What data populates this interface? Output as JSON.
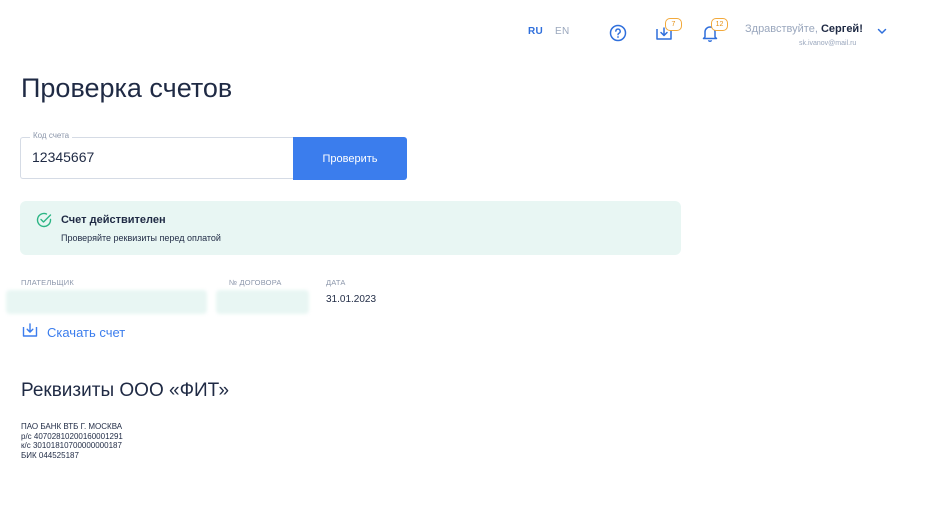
{
  "header": {
    "lang_ru": "RU",
    "lang_en": "EN",
    "downloads_count": "7",
    "notifications_count": "12",
    "greeting_prefix": "Здравствуйте, ",
    "user_name": "Сергей!",
    "email": "sk.ivanov@mail.ru",
    "icons": [
      "help-icon",
      "download-tray-icon",
      "bell-icon",
      "chevron-down-icon"
    ]
  },
  "page": {
    "title": "Проверка счетов"
  },
  "form": {
    "field_label": "Код счета",
    "field_value": "12345667",
    "submit_label": "Проверить"
  },
  "alert": {
    "title": "Счет действителен",
    "subtitle": "Проверяйте реквизиты перед оплатой",
    "icon": "check-circle-icon"
  },
  "invoice": {
    "payer_label": "ПЛАТЕЛЬЩИК",
    "contract_label": "№ ДОГОВОРА",
    "date_label": "ДАТА",
    "date_value": "31.01.2023",
    "download_label": "Скачать счет"
  },
  "requisites": {
    "title": "Реквизиты ООО «ФИТ»",
    "lines": [
      "ПАО БАНК ВТБ Г. МОСКВА",
      "р/с 40702810200160001291",
      "к/с 30101810700000000187",
      "БИК 044525187"
    ]
  },
  "colors": {
    "accent": "#3b7ded",
    "success_bg": "#e8f6f3",
    "success": "#2bb584",
    "badge": "#f2a93b"
  }
}
